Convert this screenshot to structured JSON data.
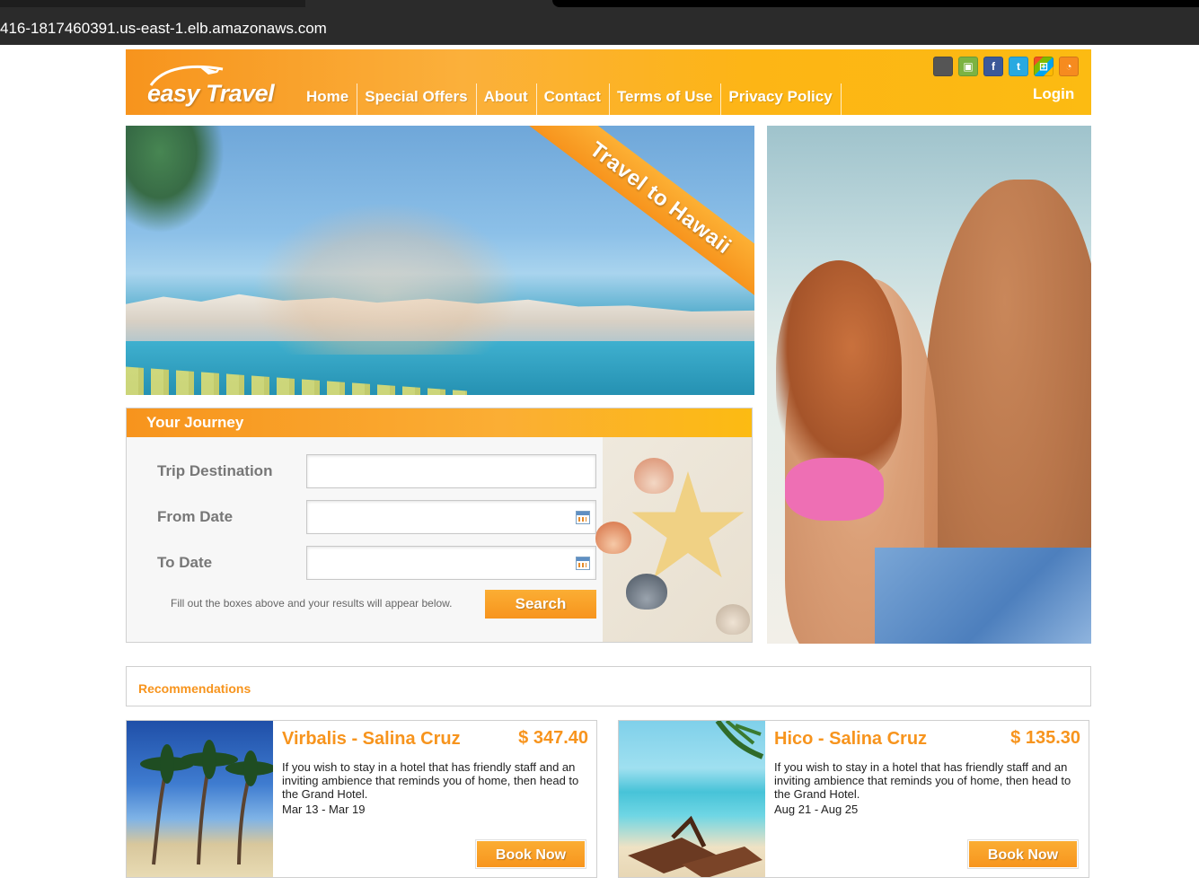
{
  "browser": {
    "url": "416-1817460391.us-east-1.elb.amazonaws.com"
  },
  "header": {
    "logo_text": "easy Travel",
    "nav": [
      "Home",
      "Special Offers",
      "About",
      "Contact",
      "Terms of Use",
      "Privacy Policy"
    ],
    "login_label": "Login",
    "social_icons": [
      {
        "name": "apple-icon",
        "glyph": "",
        "color": "#555555"
      },
      {
        "name": "android-icon",
        "glyph": "▣",
        "color": "#7cb342"
      },
      {
        "name": "facebook-icon",
        "glyph": "f",
        "color": "#3b5998"
      },
      {
        "name": "twitter-icon",
        "glyph": "t",
        "color": "#29a9e1"
      },
      {
        "name": "windows-icon",
        "glyph": "⊞",
        "color": "#f25022"
      },
      {
        "name": "rss-icon",
        "glyph": "◔",
        "color": "#f68b1f"
      }
    ]
  },
  "hero": {
    "ribbon": "Travel to Hawaii"
  },
  "journey": {
    "title": "Your Journey",
    "fields": [
      {
        "label": "Trip Destination",
        "value": "",
        "calendar": false
      },
      {
        "label": "From Date",
        "value": "",
        "calendar": true
      },
      {
        "label": "To Date",
        "value": "",
        "calendar": true
      }
    ],
    "hint": "Fill out the boxes above and your results will appear below.",
    "search_label": "Search"
  },
  "recommendations": {
    "title": "Recommendations",
    "cards": [
      {
        "title": "Virbalis - Salina Cruz",
        "price": "$ 347.40",
        "description": "If you wish to stay in a hotel that has friendly staff and an inviting ambience that reminds you of home, then head to the Grand Hotel.",
        "dates": "Mar 13 - Mar 19",
        "button": "Book Now"
      },
      {
        "title": "Hico - Salina Cruz",
        "price": "$ 135.30",
        "description": "If you wish to stay in a hotel that has friendly staff and an inviting ambience that reminds you of home, then head to the Grand Hotel.",
        "dates": "Aug 21 - Aug 25",
        "button": "Book Now"
      }
    ]
  },
  "colors": {
    "accent": "#f7941d",
    "accent_light": "#fcbb12"
  }
}
